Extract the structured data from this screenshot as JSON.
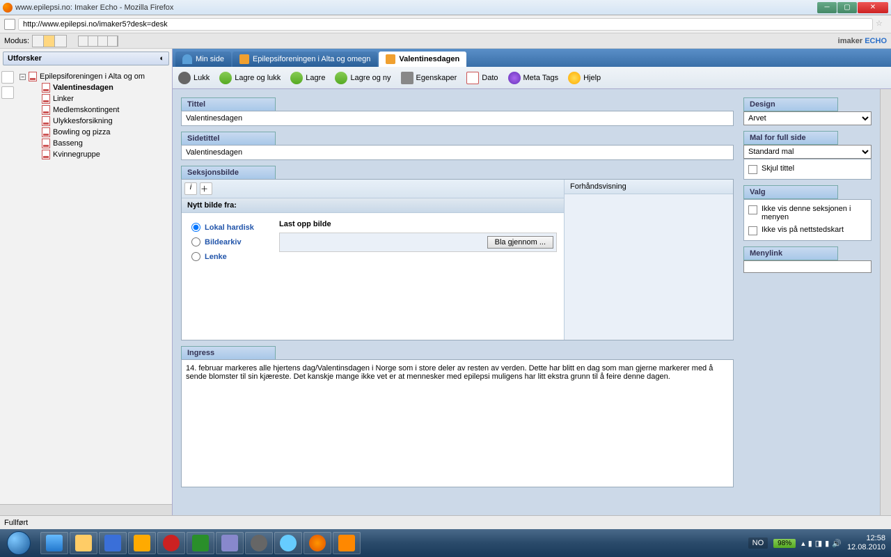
{
  "window": {
    "title": "www.epilepsi.no: Imaker Echo - Mozilla Firefox"
  },
  "url": "http://www.epilepsi.no/imaker5?desk=desk",
  "modus": {
    "label": "Modus:"
  },
  "brand": {
    "left": "imaker",
    "right": "ECHO"
  },
  "sidebar": {
    "title": "Utforsker",
    "root": "Epilepsiforeningen i Alta og om",
    "items": [
      {
        "label": "Valentinesdagen",
        "active": true
      },
      {
        "label": "Linker"
      },
      {
        "label": "Medlemskontingent"
      },
      {
        "label": "Ulykkesforsikning"
      },
      {
        "label": "Bowling og pizza"
      },
      {
        "label": "Basseng"
      },
      {
        "label": "Kvinnegruppe"
      }
    ]
  },
  "tabs": [
    {
      "label": "Min side"
    },
    {
      "label": "Epilepsiforeningen i Alta og omegn"
    },
    {
      "label": "Valentinesdagen",
      "active": true
    }
  ],
  "toolbar": {
    "close": "Lukk",
    "save_close": "Lagre og lukk",
    "save": "Lagre",
    "save_new": "Lagre og ny",
    "properties": "Egenskaper",
    "date": "Dato",
    "meta": "Meta Tags",
    "help": "Hjelp"
  },
  "editor": {
    "tittel_label": "Tittel",
    "tittel_value": "Valentinesdagen",
    "sidetittel_label": "Sidetittel",
    "sidetittel_value": "Valentinesdagen",
    "seksjon_label": "Seksjonsbilde",
    "preview_label": "Forhåndsvisning",
    "nytt_label": "Nytt bilde fra:",
    "sources": [
      {
        "label": "Lokal hardisk",
        "checked": true
      },
      {
        "label": "Bildearkiv"
      },
      {
        "label": "Lenke"
      }
    ],
    "upload_label": "Last opp bilde",
    "browse": "Bla gjennom ...",
    "ingress_label": "Ingress",
    "ingress_text": "14. februar markeres alle hjertens dag/Valentinsdagen i Norge som i store deler av resten av verden. Dette har blitt en dag som man gjerne markerer med å sende blomster til sin kjæreste. Det kanskje mange ikke vet er at mennesker med epilepsi muligens har litt ekstra grunn til å feire denne dagen."
  },
  "side": {
    "design_label": "Design",
    "design_value": "Arvet",
    "mal_label": "Mal for full side",
    "mal_value": "Standard mal",
    "skjul_tittel": "Skjul tittel",
    "valg_label": "Valg",
    "valg1": "Ikke vis denne seksjonen i menyen",
    "valg2": "Ikke vis på nettstedskart",
    "menylink_label": "Menylink"
  },
  "status": "Fullført",
  "tray": {
    "lang": "NO",
    "battery": "98%",
    "time": "12:58",
    "date": "12.08.2010"
  }
}
